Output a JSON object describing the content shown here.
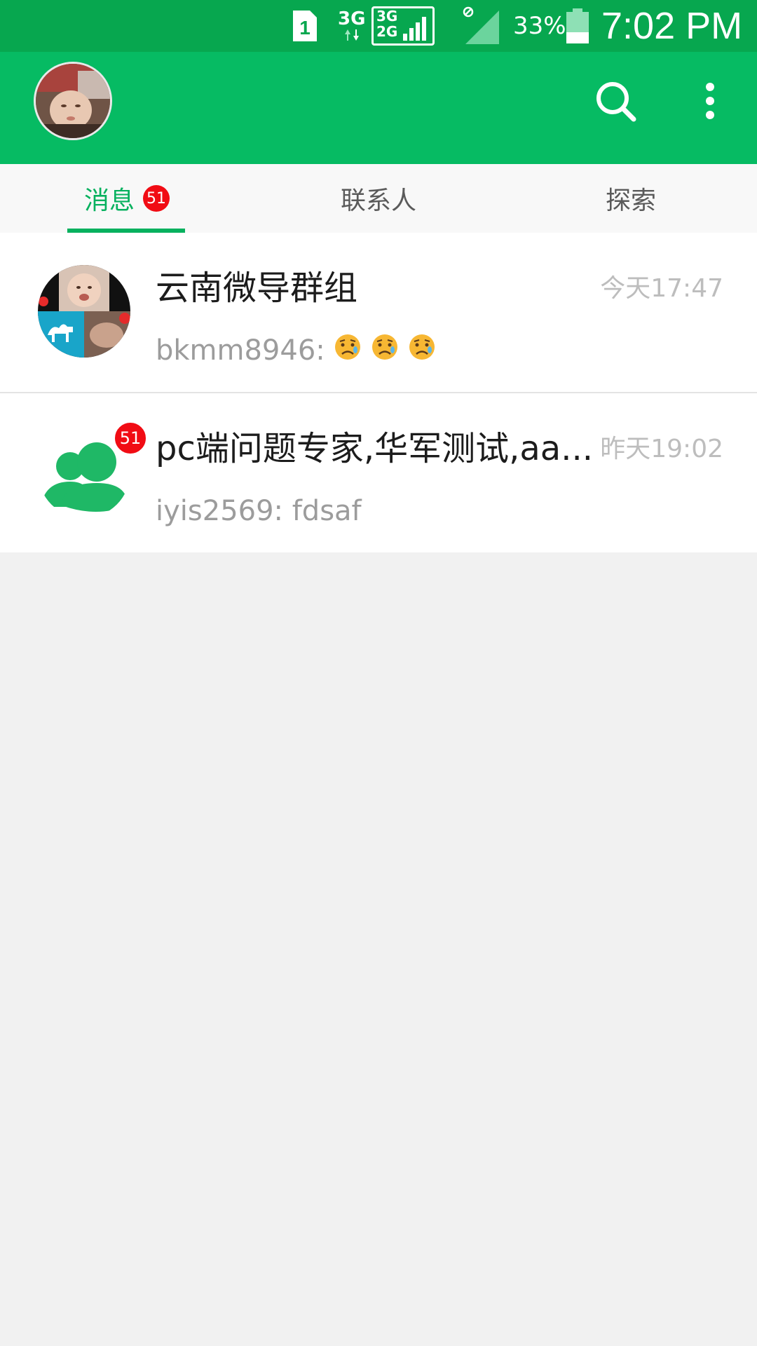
{
  "status_bar": {
    "sim_label": "1",
    "net_primary": "3G",
    "net_box_top": "3G",
    "net_box_bottom": "2G",
    "battery_percent": "33%",
    "time": "7:02 PM"
  },
  "app_bar": {
    "avatar": "user-avatar-photo",
    "search_icon": "search-icon",
    "more_icon": "more-vert-icon"
  },
  "tabs": [
    {
      "label": "消息",
      "badge": "51",
      "active": true
    },
    {
      "label": "联系人",
      "badge": "",
      "active": false
    },
    {
      "label": "探索",
      "badge": "",
      "active": false
    }
  ],
  "conversations": [
    {
      "title": "云南微导群组",
      "time": "今天17:47",
      "preview_sender": "bkmm8946: ",
      "preview_emoji_count": 3,
      "badge": "",
      "avatar": "group-photo-collage"
    },
    {
      "title": "pc端问题专家,华军测试,aa...",
      "time": "昨天19:02",
      "preview_sender": "iyis2569: fdsaf",
      "preview_emoji_count": 0,
      "badge": "51",
      "avatar": "group-people-icon"
    }
  ],
  "colors": {
    "status_bar": "#07a74f",
    "app_bar": "#06bb63",
    "accent": "#07b15e",
    "badge": "#f10c14"
  }
}
